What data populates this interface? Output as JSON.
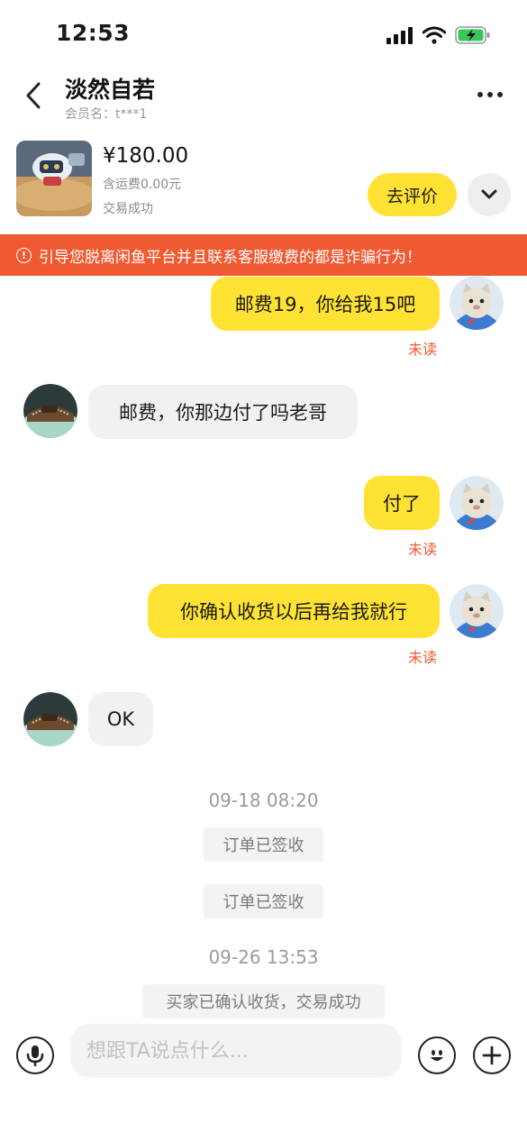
{
  "status_bar": {
    "time": "12:53"
  },
  "header": {
    "peer_name": "淡然自若",
    "member_label": "会员名：t***1"
  },
  "product": {
    "price": "¥180.00",
    "shipping": "含运费0.00元",
    "status": "交易成功",
    "review_button": "去评价"
  },
  "warning": {
    "text": "引导您脱离闲鱼平台并且联系客服缴费的都是诈骗行为！"
  },
  "messages": [
    {
      "from": "me",
      "text": "邮费19，你给我15吧",
      "status": "未读"
    },
    {
      "from": "them",
      "text": "邮费，你那边付了吗老哥"
    },
    {
      "from": "me",
      "text": "付了",
      "status": "未读"
    },
    {
      "from": "me",
      "text": "你确认收货以后再给我就行",
      "status": "未读"
    },
    {
      "from": "them",
      "text": "OK"
    }
  ],
  "timeline": {
    "time_1": "09-18 08:20",
    "system_1": "订单已签收",
    "system_2": "订单已签收",
    "time_2": "09-26 13:53",
    "system_3": "买家已确认收货，交易成功"
  },
  "input": {
    "placeholder": "想跟TA说点什么..."
  },
  "colors": {
    "accent_yellow": "#ffe233",
    "warning_red": "#f05a32",
    "other_bubble": "#f1f1f3"
  },
  "icons": [
    "back-arrow-icon",
    "more-dots-icon",
    "chevron-down-icon",
    "alert-icon",
    "microphone-icon",
    "smiley-icon",
    "plus-icon",
    "signal-icon",
    "wifi-icon",
    "battery-icon"
  ]
}
